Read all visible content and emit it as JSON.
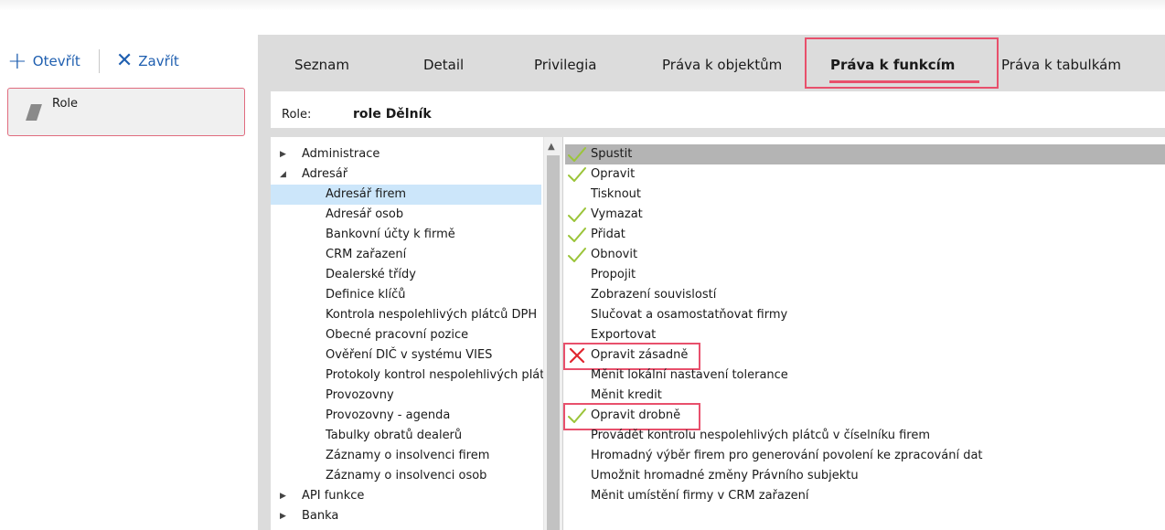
{
  "toolbar": {
    "open_label": "Otevřít",
    "close_label": "Zavřít"
  },
  "sidebar": {
    "items": [
      {
        "label": "Role"
      }
    ]
  },
  "tabs": [
    {
      "label": "Seznam",
      "active": false
    },
    {
      "label": "Detail",
      "active": false
    },
    {
      "label": "Privilegia",
      "active": false
    },
    {
      "label": "Práva k objektům",
      "active": false
    },
    {
      "label": "Práva k funkcím",
      "active": true
    },
    {
      "label": "Práva k tabulkám",
      "active": false
    }
  ],
  "role": {
    "label": "Role:",
    "value": "role Dělník"
  },
  "tree": [
    {
      "label": "Administrace",
      "state": "collapsed",
      "level": 0
    },
    {
      "label": "Adresář",
      "state": "expanded",
      "level": 0
    },
    {
      "label": "Adresář firem",
      "state": "leaf",
      "level": 1,
      "selected": true
    },
    {
      "label": "Adresář osob",
      "state": "leaf",
      "level": 1
    },
    {
      "label": "Bankovní účty k firmě",
      "state": "leaf",
      "level": 1
    },
    {
      "label": "CRM zařazení",
      "state": "leaf",
      "level": 1
    },
    {
      "label": "Dealerské třídy",
      "state": "leaf",
      "level": 1
    },
    {
      "label": "Definice klíčů",
      "state": "leaf",
      "level": 1
    },
    {
      "label": "Kontrola nespolehlivých plátců DPH",
      "state": "leaf",
      "level": 1
    },
    {
      "label": "Obecné pracovní pozice",
      "state": "leaf",
      "level": 1
    },
    {
      "label": "Ověření DIČ v systému VIES",
      "state": "leaf",
      "level": 1
    },
    {
      "label": "Protokoly kontrol nespolehlivých plátců",
      "state": "leaf",
      "level": 1
    },
    {
      "label": "Provozovny",
      "state": "leaf",
      "level": 1
    },
    {
      "label": "Provozovny - agenda",
      "state": "leaf",
      "level": 1
    },
    {
      "label": "Tabulky obratů dealerů",
      "state": "leaf",
      "level": 1
    },
    {
      "label": "Záznamy o insolvenci firem",
      "state": "leaf",
      "level": 1
    },
    {
      "label": "Záznamy o insolvenci osob",
      "state": "leaf",
      "level": 1
    },
    {
      "label": "API funkce",
      "state": "collapsed",
      "level": 0
    },
    {
      "label": "Banka",
      "state": "collapsed",
      "level": 0
    }
  ],
  "functions": [
    {
      "label": "Spustit",
      "mark": "check",
      "highlighted": true
    },
    {
      "label": "Opravit",
      "mark": "check"
    },
    {
      "label": "Tisknout",
      "mark": "none"
    },
    {
      "label": "Vymazat",
      "mark": "check"
    },
    {
      "label": "Přidat",
      "mark": "check"
    },
    {
      "label": "Obnovit",
      "mark": "check"
    },
    {
      "label": "Propojit",
      "mark": "none"
    },
    {
      "label": "Zobrazení souvislostí",
      "mark": "none"
    },
    {
      "label": "Slučovat a osamostatňovat firmy",
      "mark": "none"
    },
    {
      "label": "Exportovat",
      "mark": "none"
    },
    {
      "label": "Opravit zásadně",
      "mark": "cross",
      "boxed": true
    },
    {
      "label": "Měnit lokální nastavení tolerance",
      "mark": "none"
    },
    {
      "label": "Měnit kredit",
      "mark": "none"
    },
    {
      "label": "Opravit drobně",
      "mark": "check",
      "boxed": true
    },
    {
      "label": "Provádět kontrolu nespolehlivých plátců v číselníku firem",
      "mark": "none"
    },
    {
      "label": "Hromadný výběr firem pro generování povolení ke zpracování dat",
      "mark": "none"
    },
    {
      "label": "Umožnit hromadné změny Právního subjektu",
      "mark": "none"
    },
    {
      "label": "Měnit umístění firmy v CRM zařazení",
      "mark": "none"
    }
  ],
  "colors": {
    "accent": "#1f5fb0",
    "highlight_box": "#e8506c",
    "check": "#9bc43a",
    "cross": "#e0262f",
    "selection": "#cce6fa"
  }
}
